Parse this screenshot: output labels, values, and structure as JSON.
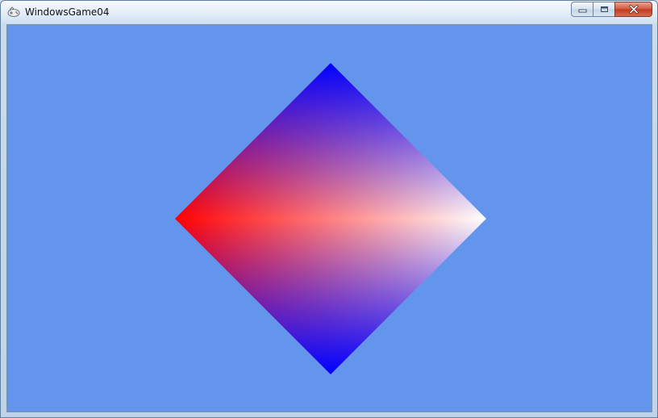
{
  "window": {
    "title": "WindowsGame04",
    "icon": "gamepad-icon",
    "buttons": {
      "minimize": "minimize-icon",
      "maximize": "maximize-icon",
      "close": "close-icon"
    }
  },
  "scene": {
    "clear_color": "#6495ed",
    "shape": "diamond",
    "vertex_colors": {
      "top": "#0000ff",
      "left": "#ff0000",
      "right": "#ffffff",
      "bottom": "#0000ff"
    }
  }
}
